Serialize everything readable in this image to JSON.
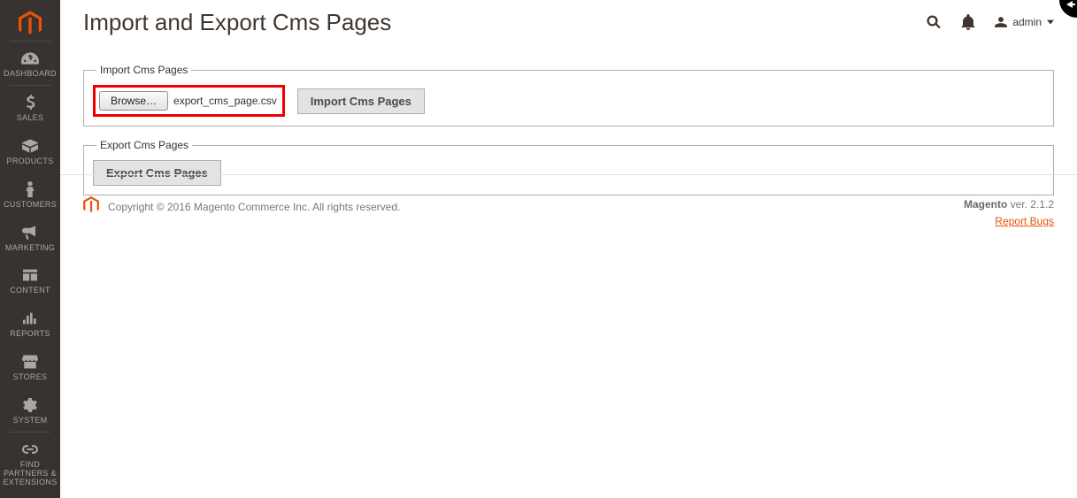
{
  "page": {
    "title": "Import and Export Cms Pages"
  },
  "user": {
    "name": "admin"
  },
  "sidebar": {
    "items": [
      {
        "label": "DASHBOARD"
      },
      {
        "label": "SALES"
      },
      {
        "label": "PRODUCTS"
      },
      {
        "label": "CUSTOMERS"
      },
      {
        "label": "MARKETING"
      },
      {
        "label": "CONTENT"
      },
      {
        "label": "REPORTS"
      },
      {
        "label": "STORES"
      },
      {
        "label": "SYSTEM"
      },
      {
        "label": "FIND PARTNERS & EXTENSIONS"
      }
    ]
  },
  "import_box": {
    "legend": "Import Cms Pages",
    "browse_label": "Browse…",
    "selected_file": "export_cms_page.csv",
    "import_button": "Import Cms Pages"
  },
  "export_box": {
    "legend": "Export Cms Pages",
    "export_button": "Export Cms Pages"
  },
  "footer": {
    "copyright": "Copyright © 2016 Magento Commerce Inc. All rights reserved.",
    "brand": "Magento",
    "version_label": " ver. 2.1.2",
    "report_link": "Report Bugs"
  }
}
